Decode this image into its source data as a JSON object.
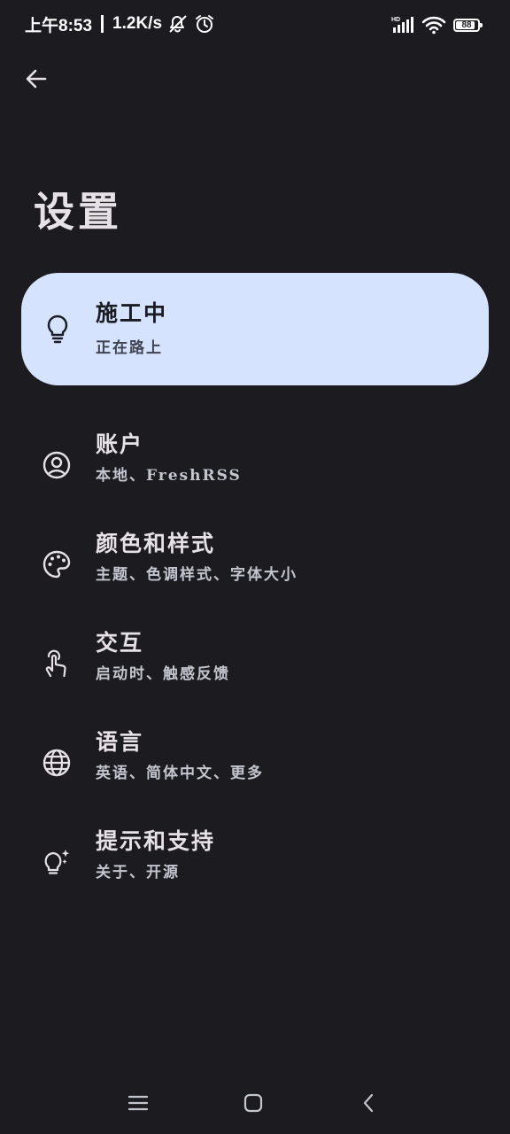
{
  "status_bar": {
    "time": "上午8:53",
    "net_speed": "1.2K/s",
    "battery": "88",
    "battery_level": 0.88
  },
  "header": {
    "title": "设置"
  },
  "highlight": {
    "title": "施工中",
    "description": "正在路上",
    "icon": "lightbulb-icon",
    "background": "#d6e3ff"
  },
  "settings": {
    "items": [
      {
        "title": "账户",
        "description": "本地、FreshRSS",
        "icon": "account-circle-icon"
      },
      {
        "title": "颜色和样式",
        "description": "主题、色调样式、字体大小",
        "icon": "palette-icon"
      },
      {
        "title": "交互",
        "description": "启动时、触感反馈",
        "icon": "touch-icon"
      },
      {
        "title": "语言",
        "description": "英语、简体中文、更多",
        "icon": "globe-icon"
      },
      {
        "title": "提示和支持",
        "description": "关于、开源",
        "icon": "tips-icon"
      }
    ]
  },
  "colors": {
    "background": "#1c1b1f",
    "text_primary": "#e6e1e5",
    "text_secondary": "#c4c6cf"
  },
  "nav_bar": {
    "icons": [
      "menu-icon",
      "home-icon",
      "back-icon"
    ]
  }
}
